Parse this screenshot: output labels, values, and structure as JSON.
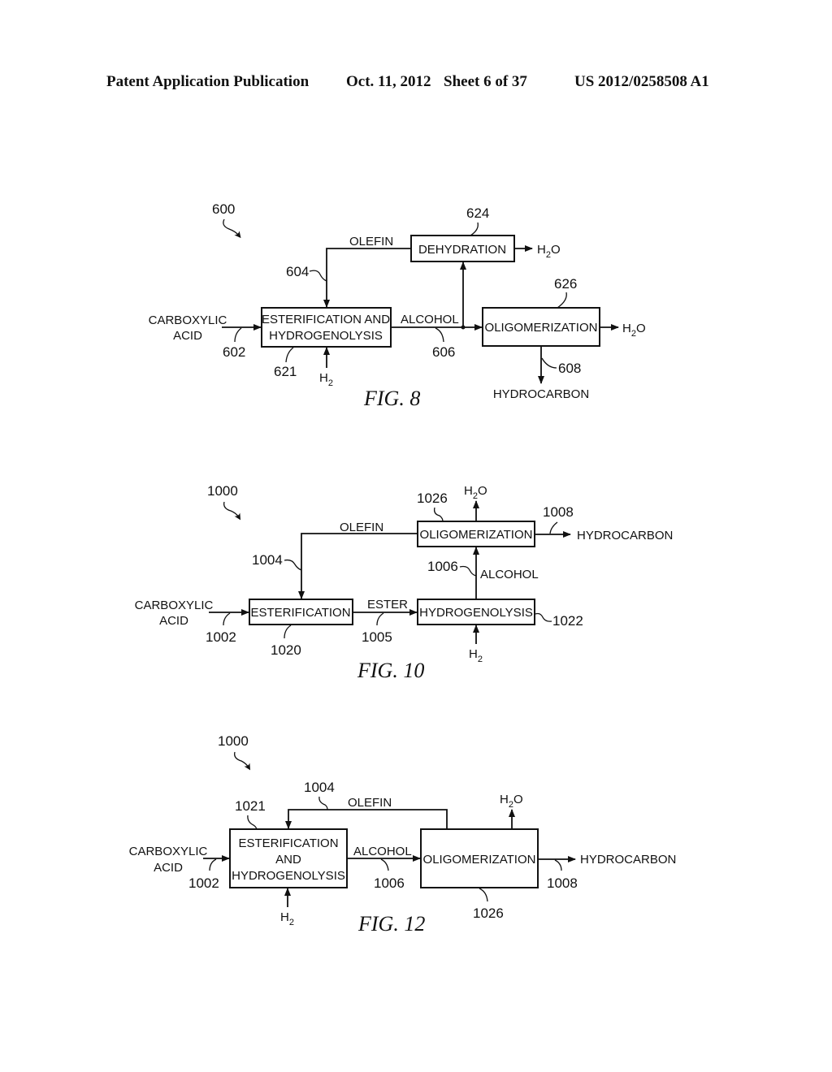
{
  "header": {
    "publication": "Patent Application Publication",
    "date": "Oct. 11, 2012",
    "sheet": "Sheet 6 of 37",
    "number": "US 2012/0258508 A1"
  },
  "fig8": {
    "caption": "FIG. 8",
    "system_ref": "600",
    "boxes": {
      "esterification_hydrogenolysis": {
        "line1": "ESTERIFICATION AND",
        "line2": "HYDROGENOLYSIS",
        "ref": "621"
      },
      "dehydration": {
        "label": "DEHYDRATION",
        "ref": "624"
      },
      "oligomerization": {
        "label": "OLIGOMERIZATION",
        "ref": "626"
      }
    },
    "streams": {
      "carboxylic_acid": {
        "line1": "CARBOXYLIC",
        "line2": "ACID",
        "ref": "602"
      },
      "olefin": {
        "label": "OLEFIN",
        "ref": "604"
      },
      "alcohol": {
        "label": "ALCOHOL",
        "ref": "606"
      },
      "hydrocarbon": {
        "label": "HYDROCARBON",
        "ref": "608"
      },
      "h2": {
        "base": "H",
        "sub": "2"
      },
      "water_dehydration": {
        "base": "H",
        "sub": "2",
        "tail": "O"
      },
      "water_oligomerization": {
        "base": "H",
        "sub": "2",
        "tail": "O"
      }
    }
  },
  "fig10": {
    "caption": "FIG. 10",
    "system_ref": "1000",
    "boxes": {
      "esterification": {
        "label": "ESTERIFICATION",
        "ref": "1020"
      },
      "hydrogenolysis": {
        "label": "HYDROGENOLYSIS",
        "ref": "1022"
      },
      "oligomerization": {
        "label": "OLIGOMERIZATION",
        "ref": "1026"
      }
    },
    "streams": {
      "carboxylic_acid": {
        "line1": "CARBOXYLIC",
        "line2": "ACID",
        "ref": "1002"
      },
      "olefin": {
        "label": "OLEFIN",
        "ref": "1004"
      },
      "ester": {
        "label": "ESTER",
        "ref": "1005"
      },
      "alcohol": {
        "label": "ALCOHOL",
        "ref": "1006"
      },
      "hydrocarbon": {
        "label": "HYDROCARBON",
        "ref": "1008"
      },
      "h2": {
        "base": "H",
        "sub": "2"
      },
      "water": {
        "base": "H",
        "sub": "2",
        "tail": "O"
      }
    }
  },
  "fig12": {
    "caption": "FIG. 12",
    "system_ref": "1000",
    "boxes": {
      "esterification_hydrogenolysis": {
        "line1": "ESTERIFICATION",
        "line2": "AND",
        "line3": "HYDROGENOLYSIS",
        "ref": "1021"
      },
      "oligomerization": {
        "label": "OLIGOMERIZATION",
        "ref": "1026"
      }
    },
    "streams": {
      "carboxylic_acid": {
        "line1": "CARBOXYLIC",
        "line2": "ACID",
        "ref": "1002"
      },
      "olefin": {
        "label": "OLEFIN",
        "ref": "1004"
      },
      "alcohol": {
        "label": "ALCOHOL",
        "ref": "1006"
      },
      "hydrocarbon": {
        "label": "HYDROCARBON",
        "ref": "1008"
      },
      "h2": {
        "base": "H",
        "sub": "2"
      },
      "water": {
        "base": "H",
        "sub": "2",
        "tail": "O"
      }
    }
  }
}
